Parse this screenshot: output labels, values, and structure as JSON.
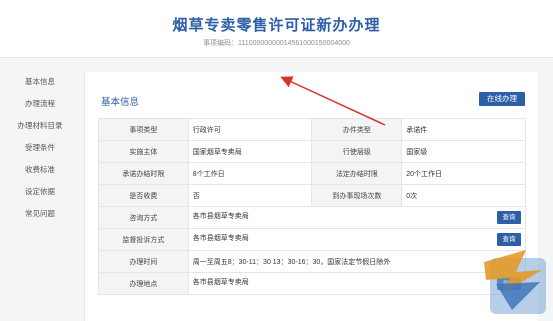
{
  "header": {
    "title": "烟草专卖零售许可证新办办理",
    "item_code": "事项编码：11100000000014561000150004000"
  },
  "sidebar": {
    "items": [
      {
        "label": "基本信息"
      },
      {
        "label": "办理流程"
      },
      {
        "label": "办理材料目录"
      },
      {
        "label": "受理条件"
      },
      {
        "label": "收费标准"
      },
      {
        "label": "设定依据"
      },
      {
        "label": "常见问题"
      }
    ]
  },
  "main": {
    "section_title": "基本信息",
    "online_button": "在线办理",
    "query_button": "查询",
    "rows": [
      {
        "l1": "事项类型",
        "v1": "行政许可",
        "l2": "办件类型",
        "v2": "承诺件"
      },
      {
        "l1": "实施主体",
        "v1": "国家烟草专卖局",
        "l2": "行使层级",
        "v2": "国家级"
      },
      {
        "l1": "承诺办结时限",
        "v1": "8个工作日",
        "l2": "法定办结时限",
        "v2": "20个工作日"
      },
      {
        "l1": "是否收费",
        "v1": "否",
        "l2": "到办事现场次数",
        "v2": "0次"
      }
    ],
    "wide_rows": [
      {
        "label": "咨询方式",
        "value": "各市县烟草专卖局",
        "button": true
      },
      {
        "label": "监督投诉方式",
        "value": "各市县烟草专卖局",
        "button": true
      },
      {
        "label": "办理时间",
        "value": "周一至周五8：30-11：30 13：30-16：30，国家法定节假日除外",
        "button": false
      },
      {
        "label": "办理地点",
        "value": "各市县烟草专卖局",
        "button": true
      }
    ]
  },
  "colors": {
    "accent": "#2d5fa6",
    "arrow": "#d9342b"
  }
}
